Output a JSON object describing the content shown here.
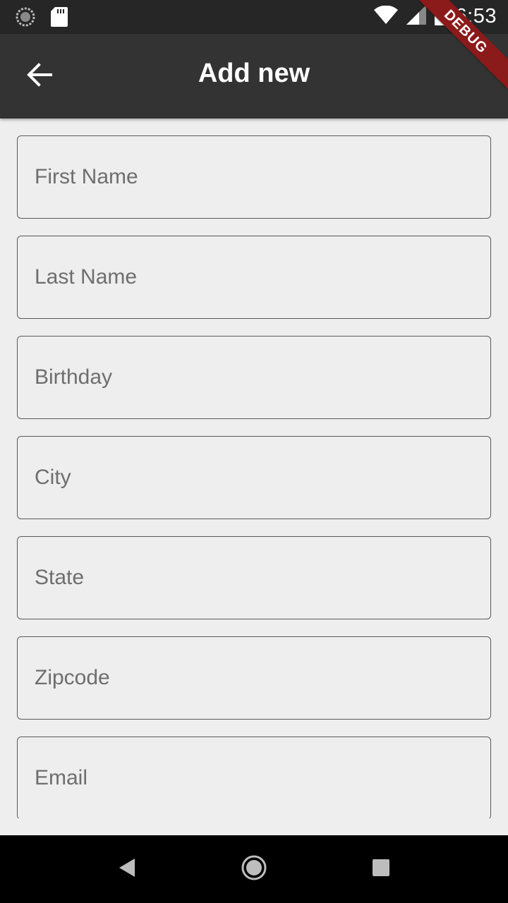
{
  "status_bar": {
    "time": "6:53",
    "icons": [
      "loading-circle-icon",
      "sd-card-icon",
      "wifi-icon",
      "cell-signal-icon",
      "battery-icon"
    ]
  },
  "app_bar": {
    "title": "Add new",
    "back_icon": "arrow-back-icon"
  },
  "debug_banner": {
    "label": "DEBUG"
  },
  "form": {
    "fields": [
      {
        "placeholder": "First Name"
      },
      {
        "placeholder": "Last Name"
      },
      {
        "placeholder": "Birthday"
      },
      {
        "placeholder": "City"
      },
      {
        "placeholder": "State"
      },
      {
        "placeholder": "Zipcode"
      },
      {
        "placeholder": "Email"
      }
    ]
  },
  "nav_bar": {
    "icons": [
      "back-triangle-icon",
      "home-circle-icon",
      "recents-square-icon"
    ]
  },
  "colors": {
    "app_bar": "#333333",
    "status_bar": "#262626",
    "background": "#eeeeee",
    "debug_ribbon": "#8b1a1a"
  }
}
